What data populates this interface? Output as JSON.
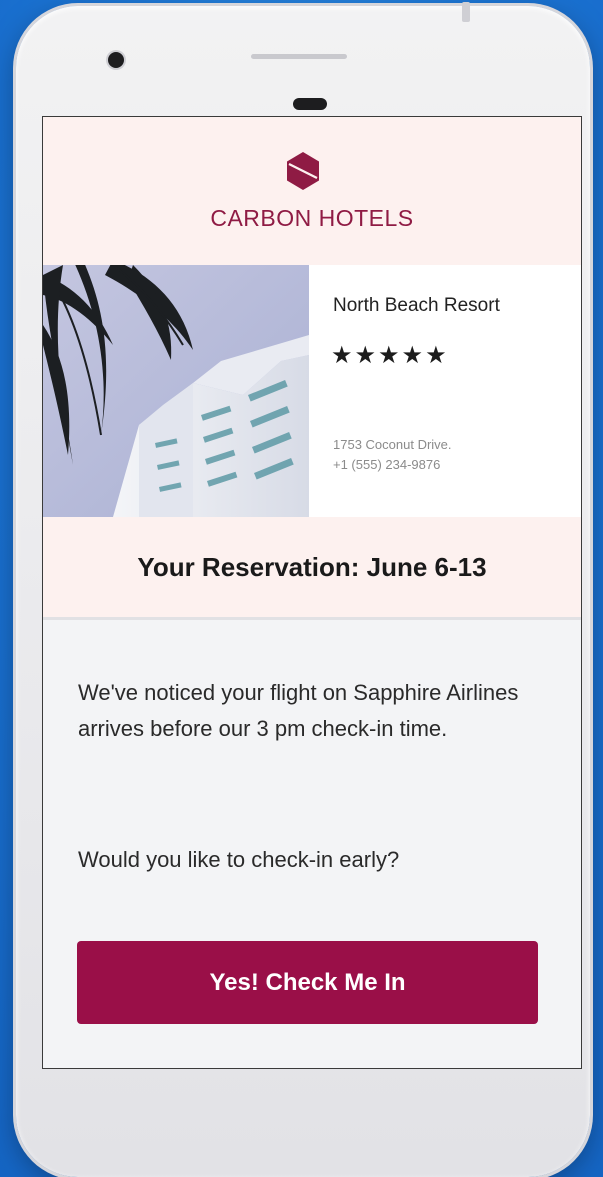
{
  "brand": {
    "name": "CARBON HOTELS",
    "color": "#8f1b44"
  },
  "hotel": {
    "name": "North Beach Resort",
    "stars": "★★★★★",
    "rating": 5,
    "address_line": "1753 Coconut Drive.",
    "phone": "+1 (555) 234-9876"
  },
  "reservation": {
    "title": "Your Reservation: June 6-13"
  },
  "message": {
    "notice": "We've noticed your flight on Sapphire Airlines arrives before our 3 pm check-in time.",
    "question": "Would you like to check-in early?"
  },
  "cta": {
    "label": "Yes! Check Me In",
    "color": "#9a0f48"
  },
  "icons": {
    "logo": "carbon-hotels-logo-icon",
    "stars": "star-icon"
  }
}
